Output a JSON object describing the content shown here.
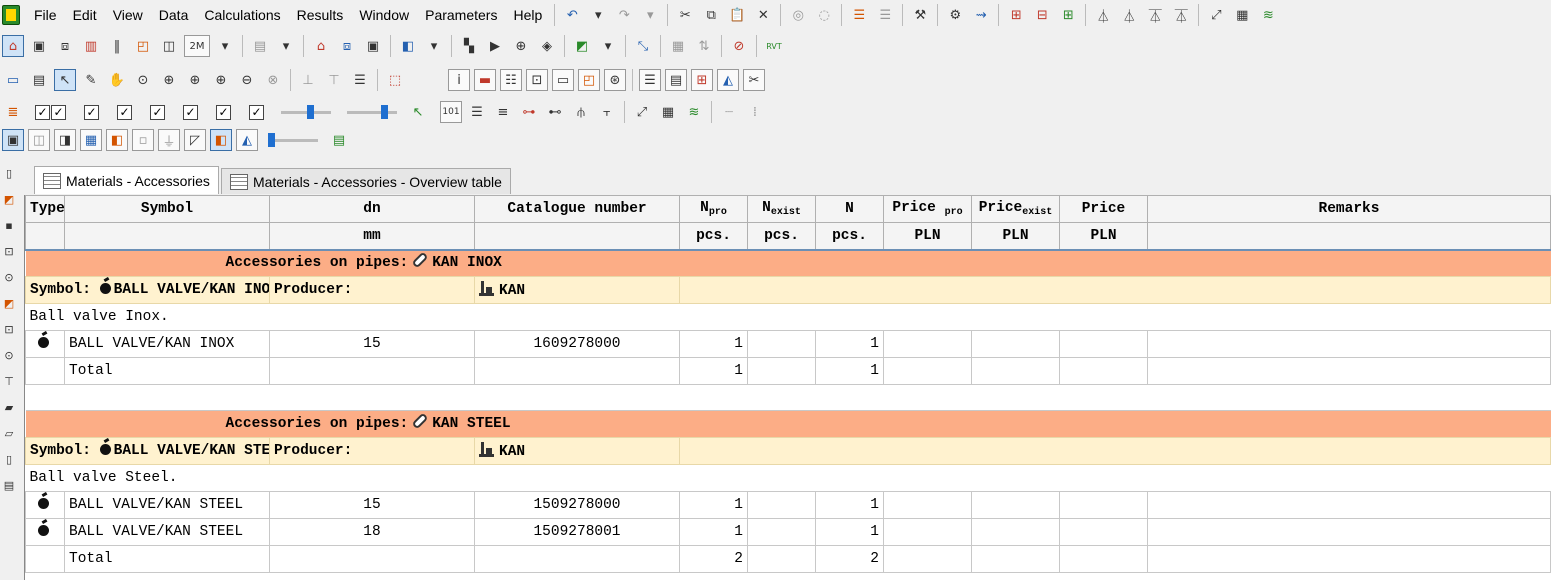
{
  "menu": [
    "File",
    "Edit",
    "View",
    "Data",
    "Calculations",
    "Results",
    "Window",
    "Parameters",
    "Help"
  ],
  "tabs": [
    "Materials - Accessories",
    "Materials - Accessories - Overview table"
  ],
  "columns": {
    "type": "Type",
    "symbol": "Symbol",
    "dn": "dn",
    "catalogue": "Catalogue number",
    "npro_main": "N",
    "npro_sub": "pro",
    "nexist_main": "N",
    "nexist_sub": "exist",
    "n": "N",
    "pricepro_main": "Price ",
    "pricepro_sub": "pro",
    "priceexist_main": "Price",
    "priceexist_sub": "exist",
    "price": "Price",
    "remarks": "Remarks"
  },
  "units": {
    "dn": "mm",
    "npro": "pcs.",
    "nexist": "pcs.",
    "n": "pcs.",
    "pricepro": "PLN",
    "priceexist": "PLN",
    "price": "PLN"
  },
  "groups": [
    {
      "section_prefix": "Accessories on pipes:",
      "section_name": "KAN INOX",
      "symbol_label": "Symbol:",
      "symbol_value": "BALL VALVE/KAN INOX",
      "producer_label": "Producer:",
      "producer_value": "KAN",
      "description": "Ball valve Inox.",
      "rows": [
        {
          "symbol": "BALL VALVE/KAN INOX",
          "dn": "15",
          "catalogue": "1609278000",
          "npro": "1",
          "n": "1"
        }
      ],
      "total_label": "Total",
      "total_npro": "1",
      "total_n": "1"
    },
    {
      "section_prefix": "Accessories on pipes:",
      "section_name": "KAN STEEL",
      "symbol_label": "Symbol:",
      "symbol_value": "BALL VALVE/KAN STEEL",
      "producer_label": "Producer:",
      "producer_value": "KAN",
      "description": "Ball valve Steel.",
      "rows": [
        {
          "symbol": "BALL VALVE/KAN STEEL",
          "dn": "15",
          "catalogue": "1509278000",
          "npro": "1",
          "n": "1"
        },
        {
          "symbol": "BALL VALVE/KAN STEEL",
          "dn": "18",
          "catalogue": "1509278001",
          "npro": "1",
          "n": "1"
        }
      ],
      "total_label": "Total",
      "total_npro": "2",
      "total_n": "2"
    }
  ],
  "colors": {
    "section_bg": "#fcad86",
    "symbol_row_bg": "#fff2cf",
    "header_bg": "#f4f4f4",
    "accent": "#6b8fb5"
  },
  "toolbar_labels": {
    "zoom_preset": "2M",
    "rvt": "RVT"
  }
}
